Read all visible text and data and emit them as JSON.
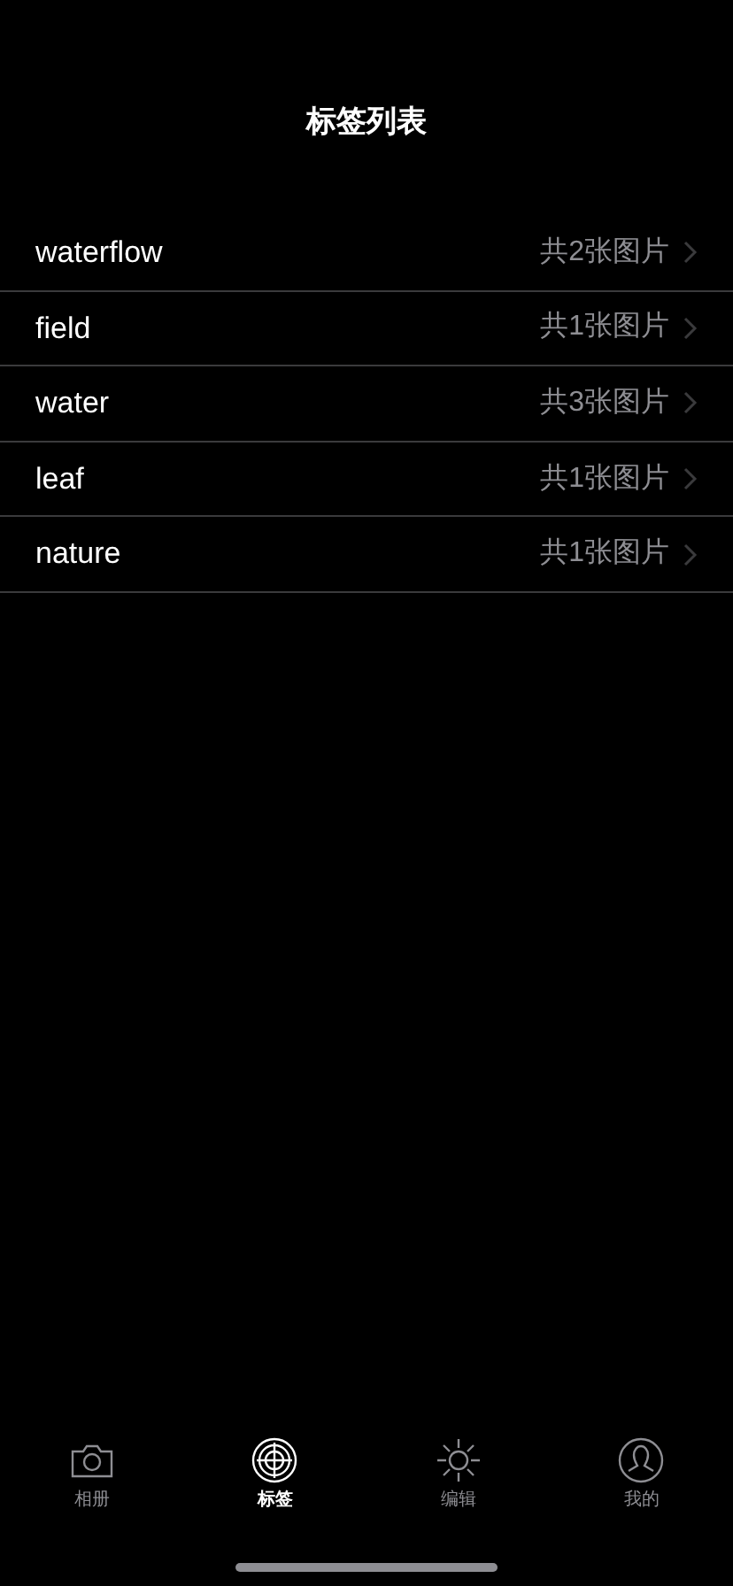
{
  "title": "标签列表",
  "tags": [
    {
      "name": "waterflow",
      "count": "共2张图片"
    },
    {
      "name": "field",
      "count": "共1张图片"
    },
    {
      "name": "water",
      "count": "共3张图片"
    },
    {
      "name": "leaf",
      "count": "共1张图片"
    },
    {
      "name": "nature",
      "count": "共1张图片"
    }
  ],
  "tab_bar": [
    {
      "label": "相册",
      "kind": "camera",
      "selected": false
    },
    {
      "label": "标签",
      "kind": "target",
      "selected": true
    },
    {
      "label": "编辑",
      "kind": "sun",
      "selected": false
    },
    {
      "label": "我的",
      "kind": "person",
      "selected": false
    }
  ]
}
